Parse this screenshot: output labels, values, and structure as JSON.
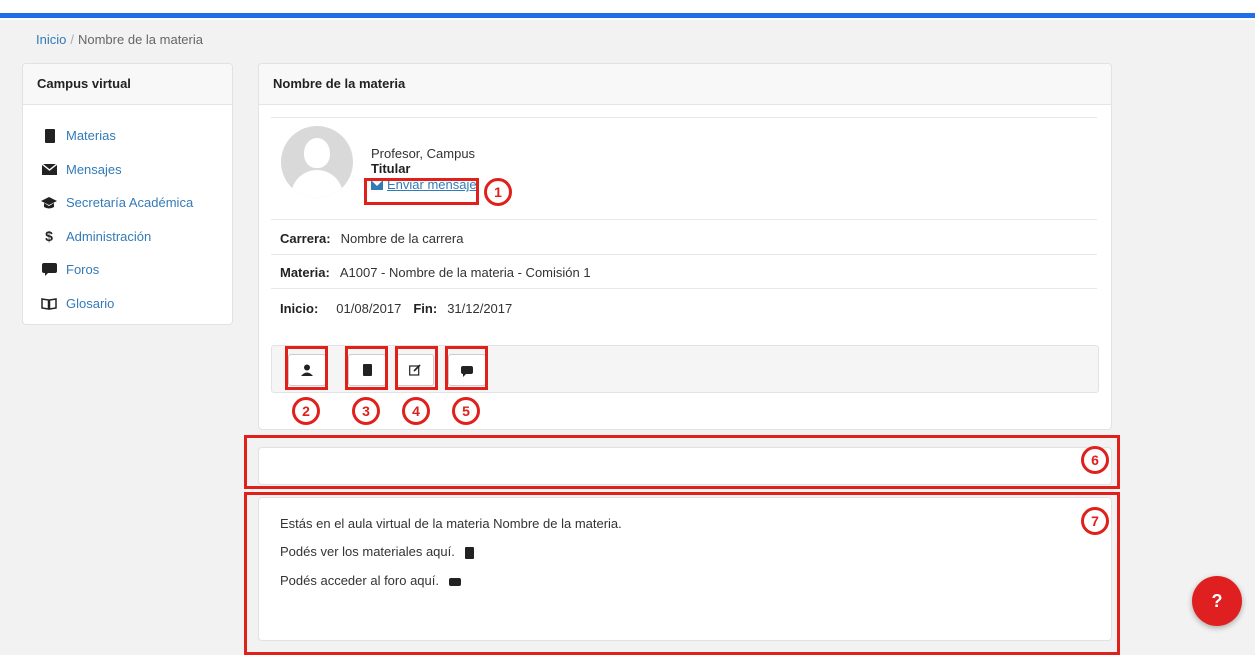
{
  "breadcrumb": {
    "home": "Inicio",
    "separator": "/",
    "current": "Nombre de la materia"
  },
  "sidebar": {
    "title": "Campus virtual",
    "items": [
      {
        "label": "Materias",
        "icon": "book-icon"
      },
      {
        "label": "Mensajes",
        "icon": "envelope-icon"
      },
      {
        "label": "Secretaría Académica",
        "icon": "graduation-cap-icon"
      },
      {
        "label": "Administración",
        "icon": "dollar-icon"
      },
      {
        "label": "Foros",
        "icon": "comment-icon"
      },
      {
        "label": "Glosario",
        "icon": "open-book-icon"
      }
    ]
  },
  "course": {
    "title": "Nombre de la materia",
    "teacher": {
      "name": "Profesor, Campus",
      "role": "Titular",
      "message_link": "Enviar mensaje"
    },
    "career_label": "Carrera:",
    "career_value": "Nombre de la carrera",
    "subject_label": "Materia:",
    "subject_value": "A1007 - Nombre de la materia - Comisión 1",
    "start_label": "Inicio:",
    "start_value": "01/08/2017",
    "end_label": "Fin:",
    "end_value": "31/12/2017",
    "toolbar": [
      "user-icon",
      "book-icon",
      "edit-icon",
      "comment-icon"
    ]
  },
  "info": {
    "line1": "Estás en el aula virtual de la materia Nombre de la materia.",
    "line2": "Podés ver los materiales aquí.",
    "line3": "Podés acceder al foro aquí."
  },
  "callouts": [
    "1",
    "2",
    "3",
    "4",
    "5",
    "6",
    "7"
  ],
  "help_button": "?",
  "colors": {
    "accent": "#1e6fe8",
    "link": "#337ab7",
    "annotation": "#e0201b",
    "help": "#e02020"
  }
}
